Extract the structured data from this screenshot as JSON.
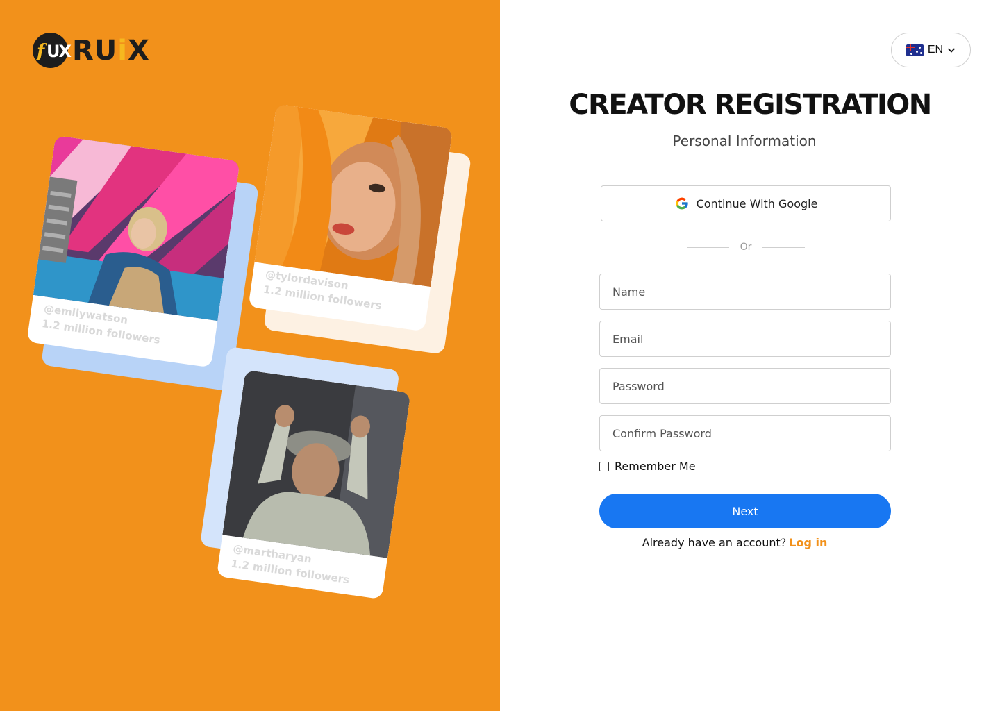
{
  "brand": {
    "badge_f": "f",
    "badge_ux": "UX",
    "name_start": "RU",
    "name_i": "i",
    "name_end": "X"
  },
  "language": {
    "code": "EN",
    "flag_icon": "australia-flag-icon"
  },
  "header": {
    "title": "CREATOR REGISTRATION",
    "subtitle": "Personal Information"
  },
  "google": {
    "label": "Continue With Google"
  },
  "divider": {
    "label": "Or"
  },
  "form": {
    "name_placeholder": "Name",
    "email_placeholder": "Email",
    "password_placeholder": "Password",
    "confirm_placeholder": "Confirm Password",
    "remember_label": "Remember Me",
    "next_label": "Next"
  },
  "login": {
    "prompt": "Already have an account?",
    "link": "Log in"
  },
  "creators": [
    {
      "handle": "@emilywatson",
      "followers": "1.2 million followers"
    },
    {
      "handle": "@tylordavison",
      "followers": "1.2 million followers"
    },
    {
      "handle": "@martharyan",
      "followers": "1.2 million followers"
    }
  ],
  "colors": {
    "accent": "#f2911b",
    "primary": "#1877f2",
    "brand_yellow": "#f6b81f"
  }
}
